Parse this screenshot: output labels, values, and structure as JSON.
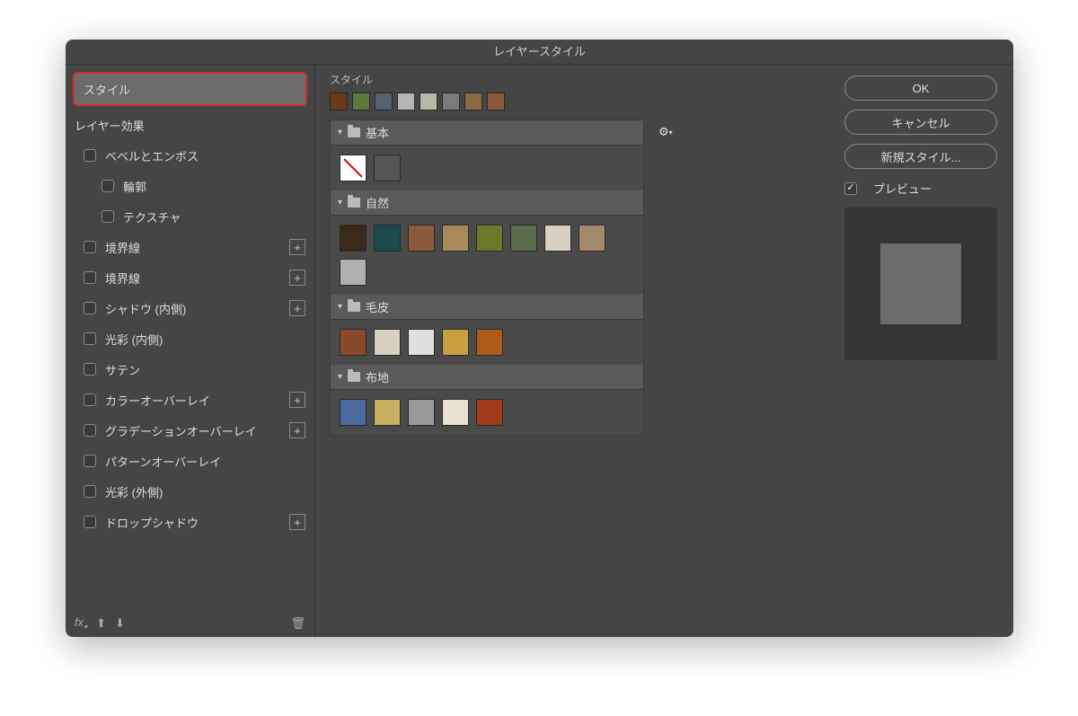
{
  "title": "レイヤースタイル",
  "left": {
    "styles": "スタイル",
    "blending": "レイヤー効果",
    "bevel": "ベベルとエンボス",
    "contour": "輪郭",
    "texture": "テクスチャ",
    "stroke1": "境界線",
    "stroke2": "境界線",
    "innerShadow": "シャドウ (内側)",
    "innerGlow": "光彩 (内側)",
    "satin": "サテン",
    "colorOverlay": "カラーオーバーレイ",
    "gradientOverlay": "グラデーションオーバーレイ",
    "patternOverlay": "パターンオーバーレイ",
    "outerGlow": "光彩 (外側)",
    "dropShadow": "ドロップシャドウ"
  },
  "center": {
    "label": "スタイル",
    "folders": {
      "basic": "基本",
      "nature": "自然",
      "fur": "毛皮",
      "fabric": "布地"
    },
    "recent": [
      "#6b3a1a",
      "#5b7a3a",
      "#556070",
      "#b5b5b5",
      "#b8b8a8",
      "#7a7a7a",
      "#8a6a45",
      "#8a5a3a"
    ],
    "basic": [
      "none",
      "#555"
    ],
    "nature": [
      "#3a2a1a",
      "#1a4a4a",
      "#8a5a3a",
      "#a88a5a",
      "#6b7a2a",
      "#5a6a4a",
      "#d8d0c0",
      "#a08a6a",
      "#b0b0b0"
    ],
    "fur": [
      "#8a4a2a",
      "#d8d0c0",
      "#e0e0e0",
      "#c8a040",
      "#b05a1a"
    ],
    "fabric": [
      "#4a6aa0",
      "#c8b060",
      "#9a9a9a",
      "#e8e0d0",
      "#a03a1a"
    ]
  },
  "right": {
    "ok": "OK",
    "cancel": "キャンセル",
    "newStyle": "新規スタイル...",
    "preview": "プレビュー"
  }
}
